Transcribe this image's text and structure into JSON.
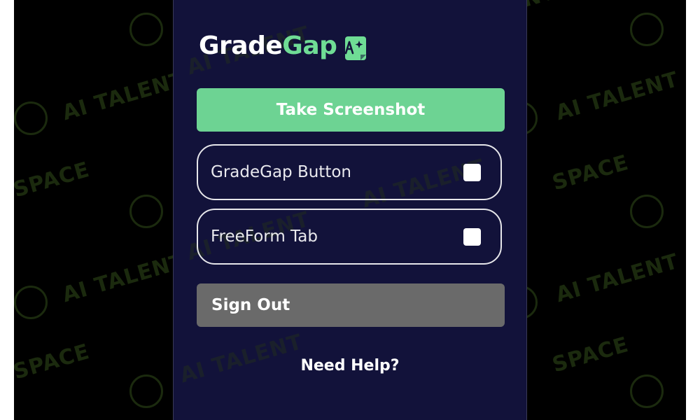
{
  "app": {
    "logo_part1": "Grade",
    "logo_part2": "Gap",
    "logo_icon": "document-sparkle-icon"
  },
  "actions": {
    "screenshot_label": "Take Screenshot",
    "signout_label": "Sign Out",
    "help_label": "Need Help?"
  },
  "toggles": [
    {
      "label": "GradeGap Button",
      "checked": false
    },
    {
      "label": "FreeForm Tab",
      "checked": false
    }
  ],
  "watermark": {
    "text_line1": "AI TALENT",
    "text_line2": "SPACE"
  },
  "colors": {
    "panel_bg": "#12123a",
    "accent_green": "#6dd393",
    "signout_gray": "#6a6a6a",
    "backdrop": "#000000"
  }
}
